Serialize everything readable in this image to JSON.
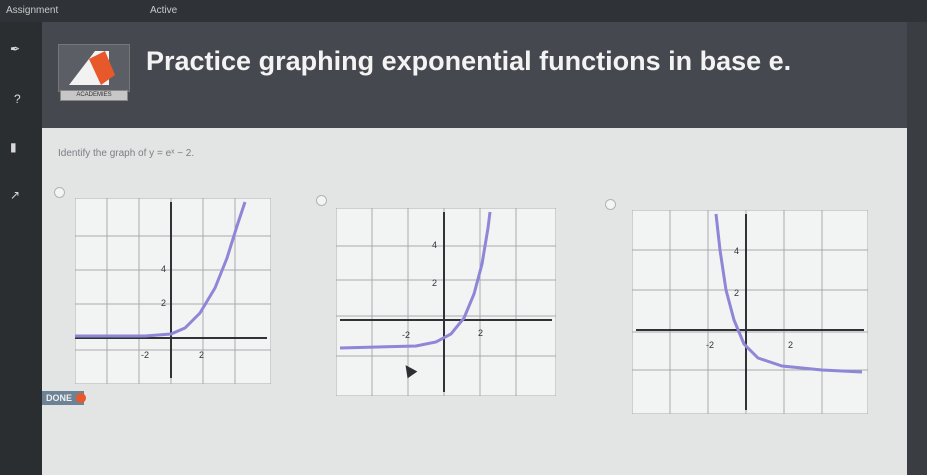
{
  "topbar": {
    "assignment_label": "Assignment",
    "active_label": "Active"
  },
  "header": {
    "title": "Practice graphing exponential functions in base e.",
    "logo_band_text": "ACADEMIES"
  },
  "question": {
    "prompt": "Identify the graph of y = eˣ − 2."
  },
  "graphs": [
    {
      "option": "A",
      "tick_labels": {
        "x": [
          "-2",
          "2"
        ],
        "y": [
          "4",
          "2"
        ]
      }
    },
    {
      "option": "B",
      "tick_labels": {
        "x": [
          "-2",
          "2"
        ],
        "y": [
          "4",
          "2"
        ]
      }
    },
    {
      "option": "C",
      "tick_labels": {
        "x": [
          "-2",
          "2"
        ],
        "y": [
          "4",
          "2"
        ]
      }
    }
  ],
  "done_button": {
    "label": "DONE"
  },
  "colors": {
    "curve": "#8e86d6",
    "grid": "#a8abae",
    "axis": "#303336",
    "done": "#6d8295",
    "done_arrow": "#e7582b"
  }
}
